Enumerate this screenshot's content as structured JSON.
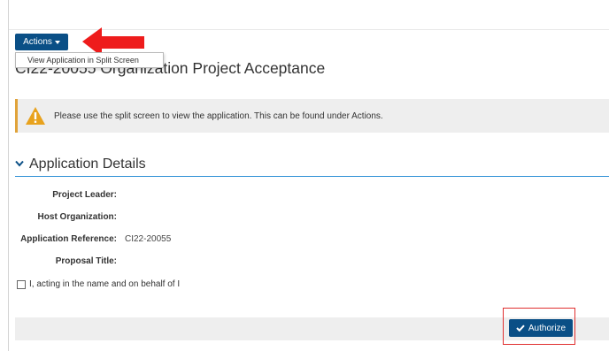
{
  "actions": {
    "label": "Actions"
  },
  "dropdown": {
    "items": [
      {
        "label": "View Application in Split Screen"
      }
    ]
  },
  "page": {
    "title": "CI22-20055 Organization Project Acceptance"
  },
  "alert": {
    "text": "Please use the split screen to view the application. This can be found under Actions.",
    "icon": "warning-icon",
    "accent_color": "#e0a33a"
  },
  "section": {
    "title": "Application Details",
    "accent_color": "#2e8fd6"
  },
  "fields": [
    {
      "label": "Project Leader:",
      "value": ""
    },
    {
      "label": "Host Organization:",
      "value": ""
    },
    {
      "label": "Application Reference:",
      "value": "CI22-20055"
    },
    {
      "label": "Proposal Title:",
      "value": ""
    }
  ],
  "consent": {
    "text": "I, acting in the name and on behalf of I",
    "checked": false
  },
  "authorize": {
    "label": "Authorize",
    "icon": "check-icon"
  },
  "colors": {
    "primary": "#0a4f86",
    "annotation_red": "#e03030"
  }
}
